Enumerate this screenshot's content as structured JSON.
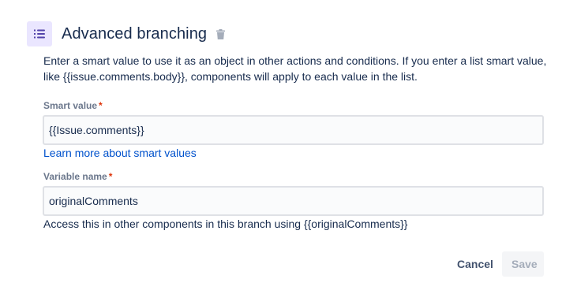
{
  "header": {
    "title": "Advanced branching",
    "icon": "list-icon",
    "delete_icon": "trash-icon",
    "icon_bg_color": "#eae6ff",
    "icon_color": "#5243aa"
  },
  "description": "Enter a smart value to use it as an object in other actions and conditions. If you enter a list smart value, like {{issue.comments.body}}, components will apply to each value in the list.",
  "smart_value_field": {
    "label": "Smart value",
    "required_marker": "*",
    "value": "{{Issue.comments}}"
  },
  "learn_more_link": "Learn more about smart values",
  "variable_name_field": {
    "label": "Variable name",
    "required_marker": "*",
    "value": "originalComments",
    "helper": "Access this in other components in this branch using {{originalComments}}"
  },
  "actions": {
    "cancel_label": "Cancel",
    "save_label": "Save"
  },
  "colors": {
    "link": "#0052cc",
    "required": "#de350b",
    "text": "#172b4d",
    "label": "#6b778c",
    "save_disabled_bg": "#f4f5f7",
    "save_disabled_text": "#a5adba"
  }
}
